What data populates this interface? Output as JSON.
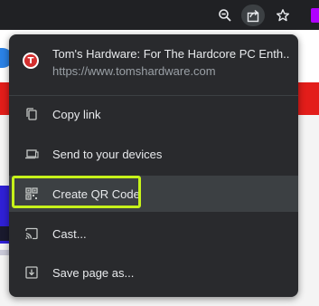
{
  "toolbar": {
    "zoom_icon": "zoom-out-icon",
    "share_icon": "share-icon",
    "star_icon": "bookmark-star-icon",
    "colors": {
      "bar": "#202124",
      "share_active": "#3c4043",
      "extension": "#b000ff"
    }
  },
  "menu": {
    "site": {
      "favicon_letter": "T",
      "title": "Tom's Hardware: For The Hardcore PC Enth...",
      "url": "https://www.tomshardware.com"
    },
    "items": [
      {
        "label": "Copy link",
        "icon": "copy-icon"
      },
      {
        "label": "Send to your devices",
        "icon": "devices-icon"
      },
      {
        "label": "Create QR Code",
        "icon": "qr-code-icon"
      },
      {
        "label": "Cast...",
        "icon": "cast-icon"
      },
      {
        "label": "Save page as...",
        "icon": "download-icon"
      }
    ],
    "highlight_color": "#c6f21a",
    "background": "#292a2d"
  }
}
